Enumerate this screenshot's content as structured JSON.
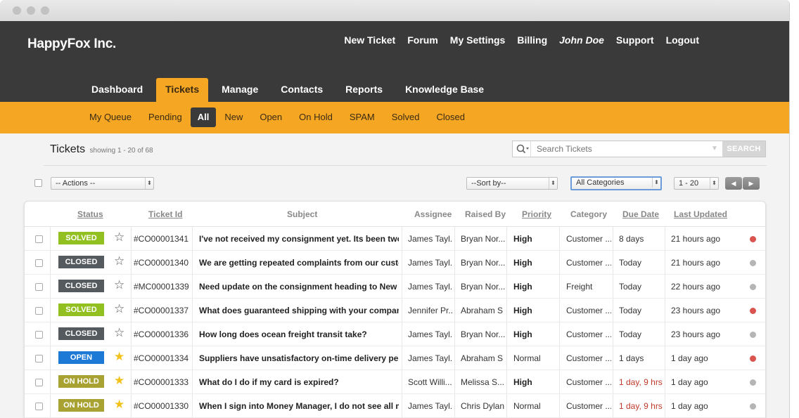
{
  "window": {
    "brand": "HappyFox Inc."
  },
  "top_nav": [
    "New Ticket",
    "Forum",
    "My Settings",
    "Billing",
    "John Doe",
    "Support",
    "Logout"
  ],
  "main_nav": {
    "tabs": [
      "Dashboard",
      "Tickets",
      "Manage",
      "Contacts",
      "Reports",
      "Knowledge Base"
    ],
    "active": "Tickets"
  },
  "sub_nav": {
    "items": [
      "My Queue",
      "Pending",
      "All",
      "New",
      "Open",
      "On Hold",
      "SPAM",
      "Solved",
      "Closed"
    ],
    "active": "All"
  },
  "page": {
    "title": "Tickets",
    "showing": "showing 1 - 20 of 68"
  },
  "search": {
    "placeholder": "Search Tickets",
    "button": "SEARCH"
  },
  "toolbar": {
    "actions": "-- Actions --",
    "sort": "--Sort by--",
    "category": "All Categories",
    "range": "1 - 20",
    "prev": "◀",
    "next": "▶"
  },
  "columns": {
    "status": "Status",
    "ticket_id": "Ticket Id",
    "subject": "Subject",
    "assignee": "Assignee",
    "raised_by": "Raised By",
    "priority": "Priority",
    "category": "Category",
    "due_date": "Due Date",
    "last_updated": "Last Updated"
  },
  "rows": [
    {
      "status": "SOLVED",
      "status_class": "solved",
      "starred": false,
      "id": "#CO00001341",
      "subject": "I've not received my consignment yet. Its been two w...",
      "assignee": "James Tayl...",
      "raised_by": "Bryan Nor...",
      "priority": "High",
      "category": "Customer ...",
      "due": "8 days",
      "due_overdue": false,
      "updated": "21 hours ago",
      "dot_color": "#d9534f"
    },
    {
      "status": "CLOSED",
      "status_class": "closed",
      "starred": false,
      "id": "#CO00001340",
      "subject": "We are getting repeated complaints from our custo...",
      "assignee": "James Tayl...",
      "raised_by": "Bryan Nor...",
      "priority": "High",
      "category": "Customer ...",
      "due": "Today",
      "due_overdue": false,
      "updated": "21 hours ago",
      "dot_color": "#b5b5b5"
    },
    {
      "status": "CLOSED",
      "status_class": "closed",
      "starred": false,
      "id": "#MC00001339",
      "subject": "Need update on the consignment heading to New Yo...",
      "assignee": "James Tayl...",
      "raised_by": "Bryan Nor...",
      "priority": "High",
      "category": "Freight",
      "due": "Today",
      "due_overdue": false,
      "updated": "22 hours ago",
      "dot_color": "#b5b5b5"
    },
    {
      "status": "SOLVED",
      "status_class": "solved",
      "starred": false,
      "id": "#CO00001337",
      "subject": "What does guaranteed shipping with your company e...",
      "assignee": "Jennifer Pr...",
      "raised_by": "Abraham S",
      "priority": "High",
      "category": "Customer ...",
      "due": "Today",
      "due_overdue": false,
      "updated": "23 hours ago",
      "dot_color": "#d9534f"
    },
    {
      "status": "CLOSED",
      "status_class": "closed",
      "starred": false,
      "id": "#CO00001336",
      "subject": "How long does ocean freight transit take?",
      "assignee": "James Tayl...",
      "raised_by": "Bryan Nor...",
      "priority": "High",
      "category": "Customer ...",
      "due": "Today",
      "due_overdue": false,
      "updated": "23 hours ago",
      "dot_color": "#b5b5b5"
    },
    {
      "status": "OPEN",
      "status_class": "open",
      "starred": true,
      "id": "#CO00001334",
      "subject": "Suppliers have unsatisfactory on-time delivery perfo...",
      "assignee": "James Tayl...",
      "raised_by": "Abraham S",
      "priority": "Normal",
      "category": "Customer ...",
      "due": "1 days",
      "due_overdue": false,
      "updated": "1 day ago",
      "dot_color": "#d9534f"
    },
    {
      "status": "ON HOLD",
      "status_class": "onhold",
      "starred": true,
      "id": "#CO00001333",
      "subject": "What do I do if my card is expired?",
      "assignee": "Scott Willi...",
      "raised_by": "Melissa S...",
      "priority": "High",
      "category": "Customer ...",
      "due": "1 day, 9 hrs",
      "due_overdue": true,
      "updated": "1 day ago",
      "dot_color": "#b5b5b5"
    },
    {
      "status": "ON HOLD",
      "status_class": "onhold",
      "starred": true,
      "id": "#CO00001330",
      "subject": "When I sign into Money Manager, I do not see all my ...",
      "assignee": "James Tayl...",
      "raised_by": "Chris Dylan",
      "priority": "Normal",
      "category": "Customer ...",
      "due": "1 day, 9 hrs",
      "due_overdue": true,
      "updated": "1 day ago",
      "dot_color": "#b5b5b5"
    }
  ]
}
